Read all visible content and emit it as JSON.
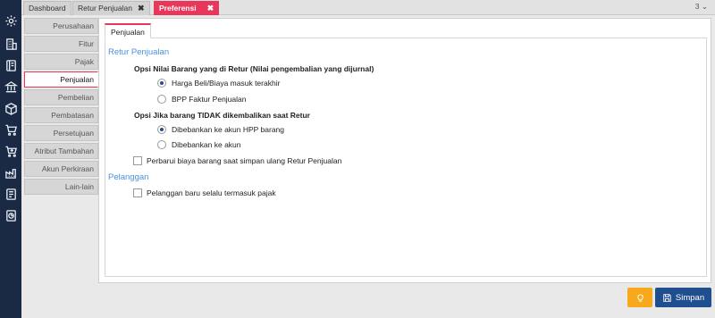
{
  "rail_icons": [
    "gear-icon",
    "building-icon",
    "book-icon",
    "bank-icon",
    "box-icon",
    "cart-icon",
    "cart-plus-icon",
    "factory-icon",
    "report-icon",
    "analytics-icon"
  ],
  "tabs": [
    {
      "label": "Dashboard",
      "closable": false
    },
    {
      "label": "Retur Penjualan",
      "closable": true
    },
    {
      "label": "Preferensi",
      "closable": true,
      "active": true
    }
  ],
  "tab_close_glyph": "✖",
  "tab_count": "3",
  "tab_menu_glyph": "⌄",
  "nav": {
    "items": [
      "Perusahaan",
      "Fitur",
      "Pajak",
      "Penjualan",
      "Pembelian",
      "Pembatasan",
      "Persetujuan",
      "Atribut Tambahan",
      "Akun Perkiraan",
      "Lain-lain"
    ],
    "active": "Penjualan"
  },
  "panel": {
    "tab_label": "Penjualan",
    "retur_heading": "Retur Penjualan",
    "nilai_heading": "Opsi Nilai Barang yang di Retur (Nilai pengembalian yang dijurnal)",
    "nilai_opt1": "Harga Beli/Biaya masuk terakhir",
    "nilai_opt2": "BPP Faktur Penjualan",
    "nilai_selected": 1,
    "tidak_heading": "Opsi Jika barang TIDAK dikembalikan saat Retur",
    "tidak_opt1": "Dibebankan ke akun HPP barang",
    "tidak_opt2": "Dibebankan ke akun",
    "tidak_selected": 1,
    "retur_checkbox": "Perbarui biaya barang saat simpan ulang Retur Penjualan",
    "pelanggan_heading": "Pelanggan",
    "pelanggan_checkbox": "Pelanggan baru selalu termasuk pajak"
  },
  "buttons": {
    "save_label": "Simpan"
  },
  "colors": {
    "accent": "#e8375a",
    "primary": "#1f4f8f",
    "warning": "#f7a81b",
    "rail": "#1b2a44",
    "section": "#4a90d9"
  }
}
